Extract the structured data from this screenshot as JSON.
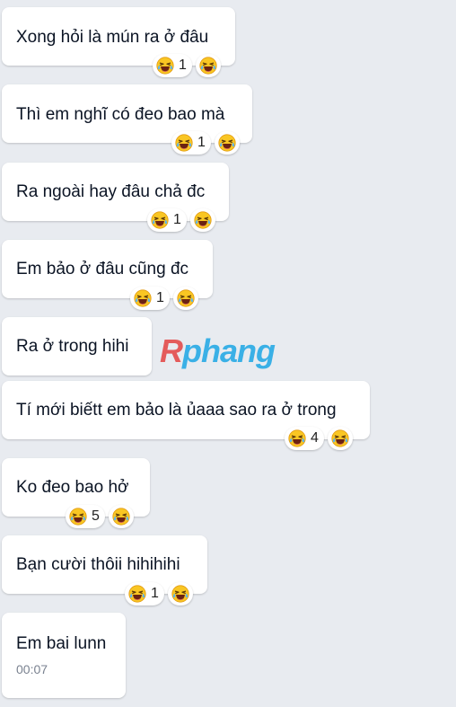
{
  "messages": [
    {
      "text": "Xong hỏi là mún ra ở đâu",
      "reaction_count": "1"
    },
    {
      "text": "Thì em nghĩ có đeo bao mà",
      "reaction_count": "1"
    },
    {
      "text": "Ra ngoài hay đâu chả đc",
      "reaction_count": "1"
    },
    {
      "text": "Em bảo ở đâu cũng đc",
      "reaction_count": "1"
    },
    {
      "text": "Ra ở trong hihi"
    },
    {
      "text": "Tí mới biếtt em bảo là ủaaa sao ra ở trong",
      "reaction_count": "4"
    },
    {
      "text": "Ko đeo bao hở",
      "reaction_count": "5"
    },
    {
      "text": "Bạn cười thôii hihihihi",
      "reaction_count": "1"
    },
    {
      "text": "Em bai lunn",
      "time": "00:07"
    }
  ],
  "reaction_icon": "laughing-crying-emoji",
  "watermark": {
    "r": "R",
    "rest": "phang"
  },
  "colors": {
    "background": "#e8ebf0",
    "bubble": "#ffffff",
    "text": "#0b1424",
    "time": "#7a8290",
    "watermark_red": "#e45b5b",
    "watermark_blue": "#3ab0e6"
  }
}
